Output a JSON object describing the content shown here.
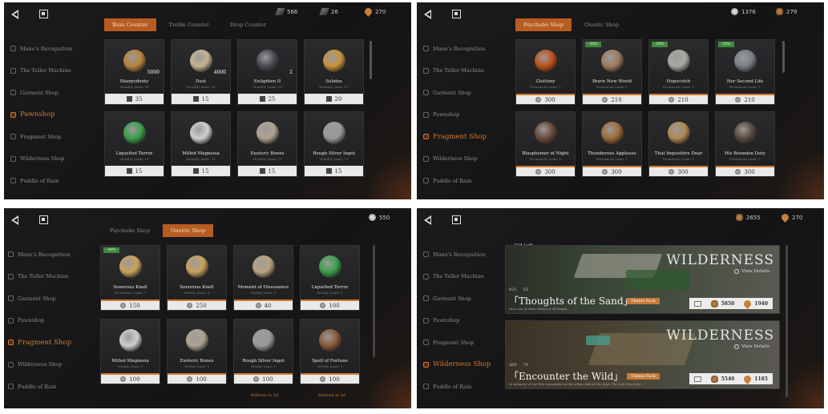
{
  "nav": {
    "menu": [
      "Mane's Recognition",
      "The Teller Machine",
      "Garment Shop",
      "Pawnshop",
      "Fragment Shop",
      "Wilderness Shop",
      "Puddle of Rain"
    ]
  },
  "p1": {
    "resources": [
      "566",
      "26",
      "270"
    ],
    "tabs": [
      "Buss Counter",
      "Treble Counter",
      "Drop Counter"
    ],
    "items": [
      {
        "name": "Sharpodenty",
        "limit": "Monthly Limit: 36",
        "price": "35",
        "qty": "5000",
        "color": "#b8843a"
      },
      {
        "name": "Dust",
        "limit": "Monthly Limit: 49",
        "price": "15",
        "qty": "4000",
        "color": "#c8b290"
      },
      {
        "name": "Enlighten II",
        "limit": "Monthly Limit: 10",
        "price": "25",
        "qty": "2",
        "color": "#4a4a52"
      },
      {
        "name": "Solidus",
        "limit": "Monthly Limit: 10",
        "price": "20",
        "qty": "",
        "color": "#c9923c"
      },
      {
        "name": "Liquefied Terror",
        "limit": "Monthly Limit: 15",
        "price": "15",
        "qty": "",
        "color": "#3aa048"
      },
      {
        "name": "Milled Magnesia",
        "limit": "Monthly Limit: 15",
        "price": "15",
        "qty": "",
        "color": "#cfcfcf"
      },
      {
        "name": "Esoteric Bones",
        "limit": "Monthly Limit: 15",
        "price": "15",
        "qty": "",
        "color": "#b0a490"
      },
      {
        "name": "Rough Silver Ingot",
        "limit": "Monthly Limit: 15",
        "price": "15",
        "qty": "",
        "color": "#9a9a9a"
      }
    ]
  },
  "p2": {
    "resources": [
      "1376",
      "279"
    ],
    "tabs": [
      "Psychube Shop",
      "Oneiric Shop"
    ],
    "items": [
      {
        "name": "Gluttony",
        "limit": "Permanent Limit: 1",
        "price": "300",
        "disc": "",
        "color": "#c0501a"
      },
      {
        "name": "Brave New World",
        "limit": "Permanent Limit: 1",
        "price": "210",
        "disc": "-30%",
        "color": "#a07a60"
      },
      {
        "name": "Hopscotch",
        "limit": "Permanent Limit: 1",
        "price": "210",
        "disc": "-30%",
        "color": "#aaa8a0"
      },
      {
        "name": "Her Second Life",
        "limit": "Permanent Limit: 1",
        "price": "210",
        "disc": "-30%",
        "color": "#7a8088"
      },
      {
        "name": "Blasphemer of Night",
        "limit": "Permanent Limit: 1",
        "price": "300",
        "disc": "",
        "color": "#6a4a3a"
      },
      {
        "name": "Thunderous Applause",
        "limit": "Permanent Limit: 1",
        "price": "300",
        "disc": "",
        "color": "#a06a3a"
      },
      {
        "name": "That Inquisitive Dear",
        "limit": "Permanent Limit: 1",
        "price": "300",
        "disc": "",
        "color": "#b08a50"
      },
      {
        "name": "His Bounden Duty",
        "limit": "Permanent Limit: 1",
        "price": "300",
        "disc": "",
        "color": "#5a4a40"
      }
    ]
  },
  "p3": {
    "resources": [
      "550"
    ],
    "tabs": [
      "Psychube Shop",
      "Oneiric Shop"
    ],
    "items": [
      {
        "name": "Sonorous Knell",
        "limit": "Permanent Limit: 7",
        "price": "150",
        "disc": "-40%",
        "color": "#c8a25a"
      },
      {
        "name": "Sonorous Knell",
        "limit": "Weekly Limit: 6",
        "price": "250",
        "disc": "",
        "color": "#c8a25a"
      },
      {
        "name": "Moment of Dissonance",
        "limit": "Weekly Limit: 5",
        "price": "40",
        "disc": "",
        "color": "#b8a480"
      },
      {
        "name": "Liquefied Terror",
        "limit": "Weekly Limit: 5",
        "price": "100",
        "disc": "",
        "color": "#3aa048"
      },
      {
        "name": "Milled Magnesia",
        "limit": "Weekly Limit: 5",
        "price": "100",
        "disc": "",
        "color": "#cfcfcf"
      },
      {
        "name": "Esoteric Bones",
        "limit": "Weekly Limit: 5",
        "price": "100",
        "disc": "",
        "color": "#b0a490"
      },
      {
        "name": "Rough Silver Ingot",
        "limit": "Weekly Limit: 5",
        "price": "100",
        "disc": "",
        "color": "#9a9a9a"
      },
      {
        "name": "Spell of Fortune",
        "limit": "Weekly Limit: 5",
        "price": "100",
        "disc": "",
        "color": "#8a5a3a"
      }
    ],
    "refresh": [
      "Refresh in 5d",
      "Refresh in 5d"
    ]
  },
  "p4": {
    "resources": [
      "2655",
      "270"
    ],
    "days": "22d Left",
    "banners": [
      {
        "title": "「Thoughts of the Sand」",
        "sub": "On a sea of dust, before it all began.",
        "s1": "821",
        "s2": "52",
        "p1": "5850",
        "p2": "1940",
        "logo": "WILDERNESS",
        "view": "View Details",
        "pack": "Theme Pack"
      },
      {
        "title": "「Encounter the Wild」",
        "sub": "In memory of our first encounter on the other side of the door. The soil, the river...",
        "s1": "260",
        "s2": "70",
        "p1": "5540",
        "p2": "1185",
        "logo": "WILDERNESS",
        "view": "View Details",
        "pack": "Theme Pack"
      }
    ]
  }
}
